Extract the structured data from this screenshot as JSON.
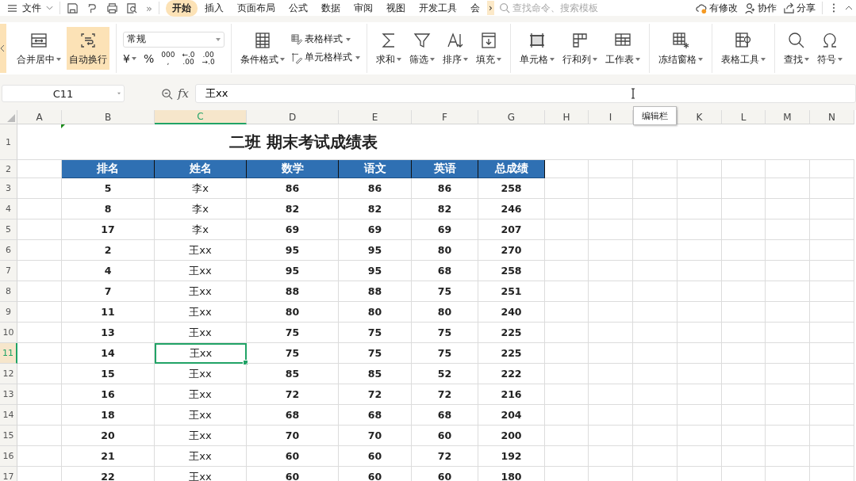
{
  "menu_bar": {
    "file_menu": "文件",
    "more": "»",
    "tabs": [
      {
        "label": "开始",
        "selected": true
      },
      {
        "label": "插入",
        "selected": false
      },
      {
        "label": "页面布局",
        "selected": false
      },
      {
        "label": "公式",
        "selected": false
      },
      {
        "label": "数据",
        "selected": false
      },
      {
        "label": "审阅",
        "selected": false
      },
      {
        "label": "视图",
        "selected": false
      },
      {
        "label": "开发工具",
        "selected": false
      },
      {
        "label": "会",
        "selected": false
      }
    ],
    "tabs_more": "›",
    "search": {
      "placeholder": "查找命令、搜索模板"
    },
    "actions": [
      "有修改",
      "协作",
      "分享"
    ]
  },
  "ribbon": {
    "buttons": [
      {
        "label": "合并居中",
        "dropdown": true,
        "selected": false
      },
      {
        "label": "自动换行",
        "dropdown": false,
        "selected": true
      },
      {
        "label": "条件格式",
        "dropdown": true,
        "selected": false
      },
      {
        "label": "表格样式",
        "dropdown": true,
        "selected": false
      },
      {
        "label": "单元格样式",
        "dropdown": true,
        "selected": false
      },
      {
        "label": "求和",
        "dropdown": true,
        "selected": false
      },
      {
        "label": "筛选",
        "dropdown": true,
        "selected": false
      },
      {
        "label": "排序",
        "dropdown": true,
        "selected": false
      },
      {
        "label": "填充",
        "dropdown": true,
        "selected": false
      },
      {
        "label": "单元格",
        "dropdown": true,
        "selected": false
      },
      {
        "label": "行和列",
        "dropdown": true,
        "selected": false
      },
      {
        "label": "工作表",
        "dropdown": true,
        "selected": false
      },
      {
        "label": "冻结窗格",
        "dropdown": true,
        "selected": false
      },
      {
        "label": "表格工具",
        "dropdown": true,
        "selected": false
      },
      {
        "label": "查找",
        "dropdown": true,
        "selected": false
      },
      {
        "label": "符号",
        "dropdown": true,
        "selected": false
      }
    ],
    "number_format": {
      "value": "常规",
      "buttons": [
        {
          "lines": [
            "¥"
          ],
          "dropdown": true
        },
        {
          "lines": [
            "%"
          ],
          "dropdown": false
        },
        {
          "lines": [
            "000",
            ","
          ],
          "dropdown": false
        },
        {
          "lines": [
            "←.0",
            ".00"
          ],
          "dropdown": false
        },
        {
          "lines": [
            ".00",
            "→.0"
          ],
          "dropdown": false
        }
      ]
    }
  },
  "formula_bar": {
    "name_box": "C11",
    "fx": "fx",
    "value": "王xx"
  },
  "tooltip": "编辑栏",
  "sheet": {
    "columns": [
      {
        "label": "A",
        "selected": false
      },
      {
        "label": "B",
        "selected": false
      },
      {
        "label": "C",
        "selected": true
      },
      {
        "label": "D",
        "selected": false
      },
      {
        "label": "E",
        "selected": false
      },
      {
        "label": "F",
        "selected": false
      },
      {
        "label": "G",
        "selected": false
      },
      {
        "label": "H",
        "selected": false
      },
      {
        "label": "I",
        "selected": false
      },
      {
        "label": "K",
        "selected": false
      },
      {
        "label": "L",
        "selected": false
      },
      {
        "label": "M",
        "selected": false
      },
      {
        "label": "N",
        "selected": false
      }
    ],
    "title_row": {
      "number": "1",
      "title": "二班 期末考试成绩表"
    },
    "header_row": {
      "number": "2",
      "cells": [
        "",
        "排名",
        "姓名",
        "数学",
        "语文",
        "英语",
        "总成绩"
      ]
    },
    "rows": [
      {
        "number": "3",
        "selected": false,
        "cells": [
          "",
          "5",
          "李x",
          "86",
          "86",
          "86",
          "258"
        ]
      },
      {
        "number": "4",
        "selected": false,
        "cells": [
          "",
          "8",
          "李x",
          "82",
          "82",
          "82",
          "246"
        ]
      },
      {
        "number": "5",
        "selected": false,
        "cells": [
          "",
          "17",
          "李x",
          "69",
          "69",
          "69",
          "207"
        ]
      },
      {
        "number": "6",
        "selected": false,
        "cells": [
          "",
          "2",
          "王xx",
          "95",
          "95",
          "80",
          "270"
        ]
      },
      {
        "number": "7",
        "selected": false,
        "cells": [
          "",
          "4",
          "王xx",
          "95",
          "95",
          "68",
          "258"
        ]
      },
      {
        "number": "8",
        "selected": false,
        "cells": [
          "",
          "7",
          "王xx",
          "88",
          "88",
          "75",
          "251"
        ]
      },
      {
        "number": "9",
        "selected": false,
        "cells": [
          "",
          "11",
          "王xx",
          "80",
          "80",
          "80",
          "240"
        ]
      },
      {
        "number": "10",
        "selected": false,
        "cells": [
          "",
          "13",
          "王xx",
          "75",
          "75",
          "75",
          "225"
        ]
      },
      {
        "number": "11",
        "selected": true,
        "cells": [
          "",
          "14",
          "王xx",
          "75",
          "75",
          "75",
          "225"
        ]
      },
      {
        "number": "12",
        "selected": false,
        "cells": [
          "",
          "15",
          "王xx",
          "85",
          "85",
          "52",
          "222"
        ]
      },
      {
        "number": "13",
        "selected": false,
        "cells": [
          "",
          "16",
          "王xx",
          "72",
          "72",
          "72",
          "216"
        ]
      },
      {
        "number": "14",
        "selected": false,
        "cells": [
          "",
          "18",
          "王xx",
          "68",
          "68",
          "68",
          "204"
        ]
      },
      {
        "number": "15",
        "selected": false,
        "cells": [
          "",
          "20",
          "王xx",
          "70",
          "70",
          "60",
          "200"
        ]
      },
      {
        "number": "16",
        "selected": false,
        "cells": [
          "",
          "21",
          "王xx",
          "60",
          "60",
          "72",
          "192"
        ]
      },
      {
        "number": "17",
        "selected": false,
        "cells": [
          "",
          "22",
          "王xx",
          "60",
          "60",
          "60",
          "180"
        ]
      }
    ]
  }
}
